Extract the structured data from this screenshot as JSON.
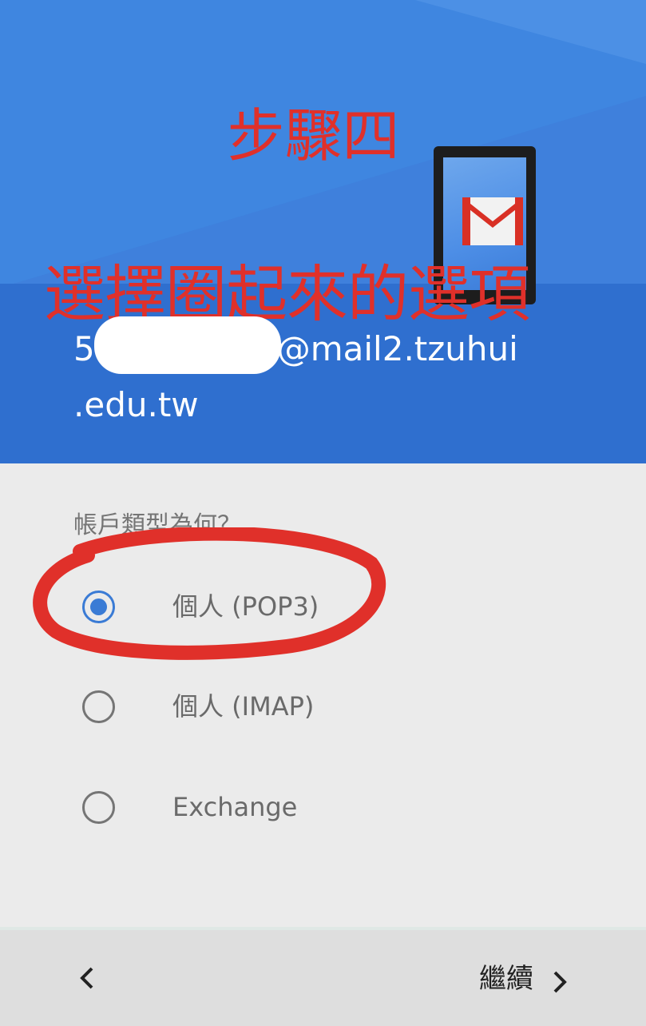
{
  "annotations": {
    "step": "步驟四",
    "instruction": "選擇圈起來的選項"
  },
  "account": {
    "email_prefix": "5",
    "email_suffix": "@mail2.tzuhui",
    "email_line2": ".edu.tw"
  },
  "question": "帳戶類型為何？",
  "options": [
    {
      "label": "個人 (POP3)",
      "selected": true
    },
    {
      "label": "個人 (IMAP)",
      "selected": false
    },
    {
      "label": "Exchange",
      "selected": false
    }
  ],
  "footer": {
    "back_icon": "‹",
    "continue_label": "繼續"
  },
  "colors": {
    "header_blue": "#3f80dc",
    "accent_blue": "#3a7bd5",
    "annotation_red": "#e0302a"
  }
}
